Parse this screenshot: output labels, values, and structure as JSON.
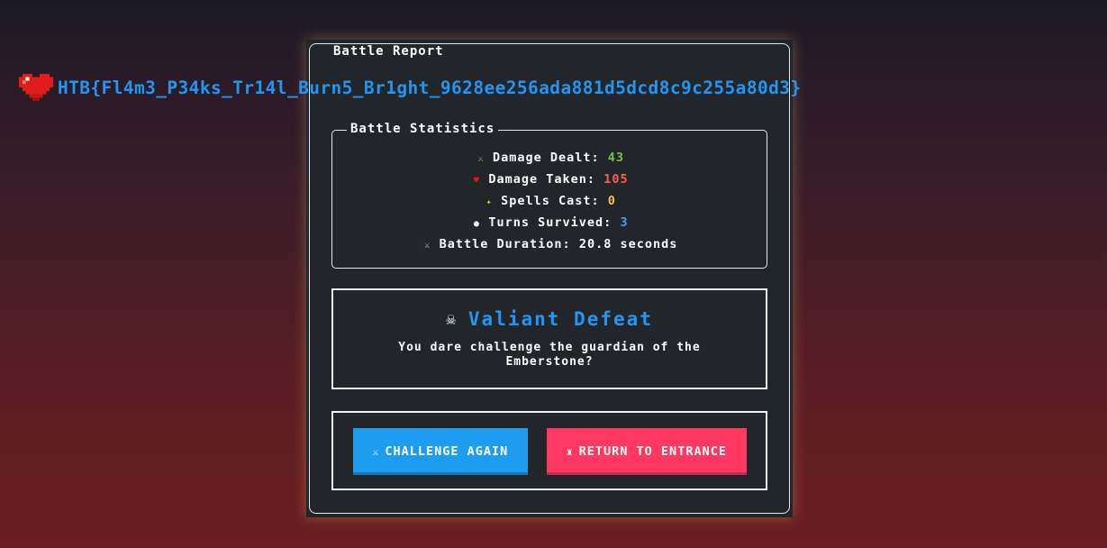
{
  "flag": {
    "icon": "heart-icon",
    "text": "HTB{Fl4m3_P34ks_Tr14l_Burn5_Br1ght_9628ee256ada881d5dcd8c9c255a80d3}"
  },
  "report": {
    "title": "Battle Report"
  },
  "stats": {
    "title": "Battle Statistics",
    "items": [
      {
        "icon": "sword-icon",
        "label": "Damage Dealt:",
        "value": "43",
        "color": "#7bc043"
      },
      {
        "icon": "heart-icon",
        "label": "Damage Taken:",
        "value": "105",
        "color": "#ff5f4a"
      },
      {
        "icon": "sparkle-icon",
        "label": "Spells Cast:",
        "value": "0",
        "color": "#f5c542"
      },
      {
        "icon": "stopwatch-icon",
        "label": "Turns Survived:",
        "value": "3",
        "color": "#3ba0ff"
      },
      {
        "icon": "crossed-swords-icon",
        "label": "Battle Duration:",
        "value": "20.8 seconds",
        "color": "#ffffff"
      }
    ]
  },
  "result": {
    "icon": "skull-icon",
    "title": "Valiant Defeat",
    "message": "You dare challenge the guardian of the Emberstone?"
  },
  "actions": {
    "challenge": {
      "icon": "crossed-swords-icon",
      "label": "CHALLENGE AGAIN"
    },
    "return": {
      "icon": "castle-icon",
      "label": "RETURN TO ENTRANCE"
    }
  },
  "colors": {
    "accent_blue": "#2196f3",
    "button_blue": "#1e9cef",
    "button_red": "#ff3862",
    "panel": "#22252a"
  }
}
